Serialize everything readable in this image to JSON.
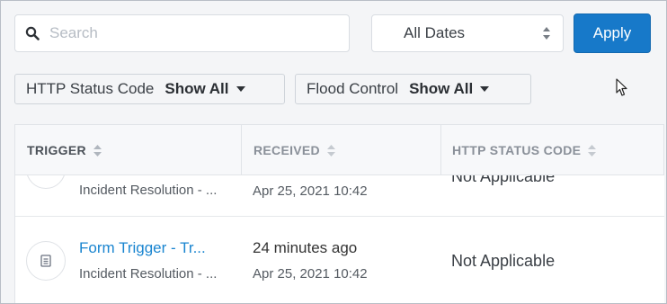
{
  "search": {
    "placeholder": "Search",
    "value": ""
  },
  "date_filter": {
    "selected": "All Dates"
  },
  "apply_label": "Apply",
  "filters": [
    {
      "label": "HTTP Status Code",
      "value": "Show All"
    },
    {
      "label": "Flood Control",
      "value": "Show All"
    }
  ],
  "table": {
    "columns": [
      "TRIGGER",
      "RECEIVED",
      "HTTP STATUS CODE"
    ],
    "rows": [
      {
        "trigger": "",
        "subtitle": "Incident Resolution - ...",
        "received_ago": "",
        "received_date": "Apr 25, 2021 10:42",
        "status": "Not Applicable"
      },
      {
        "trigger": "Form Trigger - Tr...",
        "subtitle": "Incident Resolution - ...",
        "received_ago": "24 minutes ago",
        "received_date": "Apr 25, 2021 10:42",
        "status": "Not Applicable"
      }
    ]
  },
  "colors": {
    "accent": "#1779c9",
    "link": "#1a85d0",
    "background": "#f4f5f7"
  },
  "icons": {
    "search": "search-icon",
    "select_arrows": "sort-arrows-icon",
    "caret": "caret-down-icon",
    "cursor": "mouse-cursor-icon",
    "row": "document-icon"
  }
}
